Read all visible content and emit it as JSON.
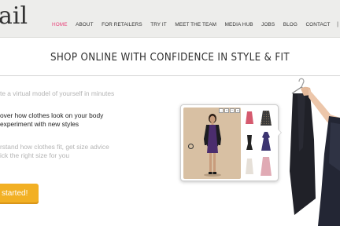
{
  "header": {
    "logo_text": "ail",
    "nav": [
      {
        "label": "HOME",
        "active": true
      },
      {
        "label": "ABOUT",
        "active": false
      },
      {
        "label": "FOR RETAILERS",
        "active": false
      },
      {
        "label": "TRY IT",
        "active": false
      },
      {
        "label": "MEET THE TEAM",
        "active": false
      },
      {
        "label": "MEDIA HUB",
        "active": false
      },
      {
        "label": "JOBS",
        "active": false
      },
      {
        "label": "BLOG",
        "active": false
      },
      {
        "label": "CONTACT",
        "active": false
      }
    ],
    "separator": "|",
    "twitter_icon_glyph": "t"
  },
  "banner": {
    "title": "SHOP ONLINE WITH CONFIDENCE IN STYLE & FIT"
  },
  "features": [
    {
      "text": "te a virtual model of yourself in minutes"
    },
    {
      "line1": "over how clothes look on your body",
      "line2": "experiment with new styles"
    },
    {
      "line1": "rstand how clothes fit, get size advice",
      "line2": "ick the right size for you"
    }
  ],
  "cta": {
    "label": "started!"
  },
  "colors": {
    "accent_pink": "#e8437a",
    "cta_orange": "#f2b024",
    "header_bg": "#ededeb",
    "stage_bg": "#d8c0a3"
  }
}
